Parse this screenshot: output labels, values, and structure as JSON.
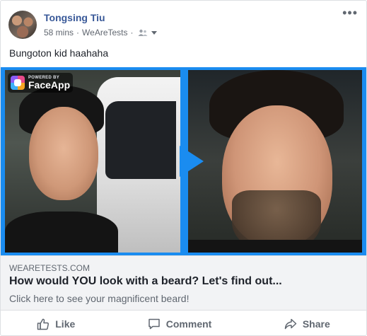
{
  "post": {
    "author": "Tongsing Tiu",
    "time": "58 mins",
    "separator": "·",
    "page": "WeAreTests",
    "text": "Bungoton kid haahaha",
    "more_icon": "more-horizontal-icon",
    "audience_icon": "friends-icon"
  },
  "media": {
    "badge_powered": "POWERED BY",
    "badge_brand": "FaceApp",
    "accent_color": "#1a8cf0"
  },
  "link": {
    "domain": "WEARETESTS.COM",
    "headline": "How would YOU look with a beard? Let's find out...",
    "description": "Click here to see your magnificent beard!"
  },
  "actions": {
    "like": "Like",
    "comment": "Comment",
    "share": "Share"
  }
}
